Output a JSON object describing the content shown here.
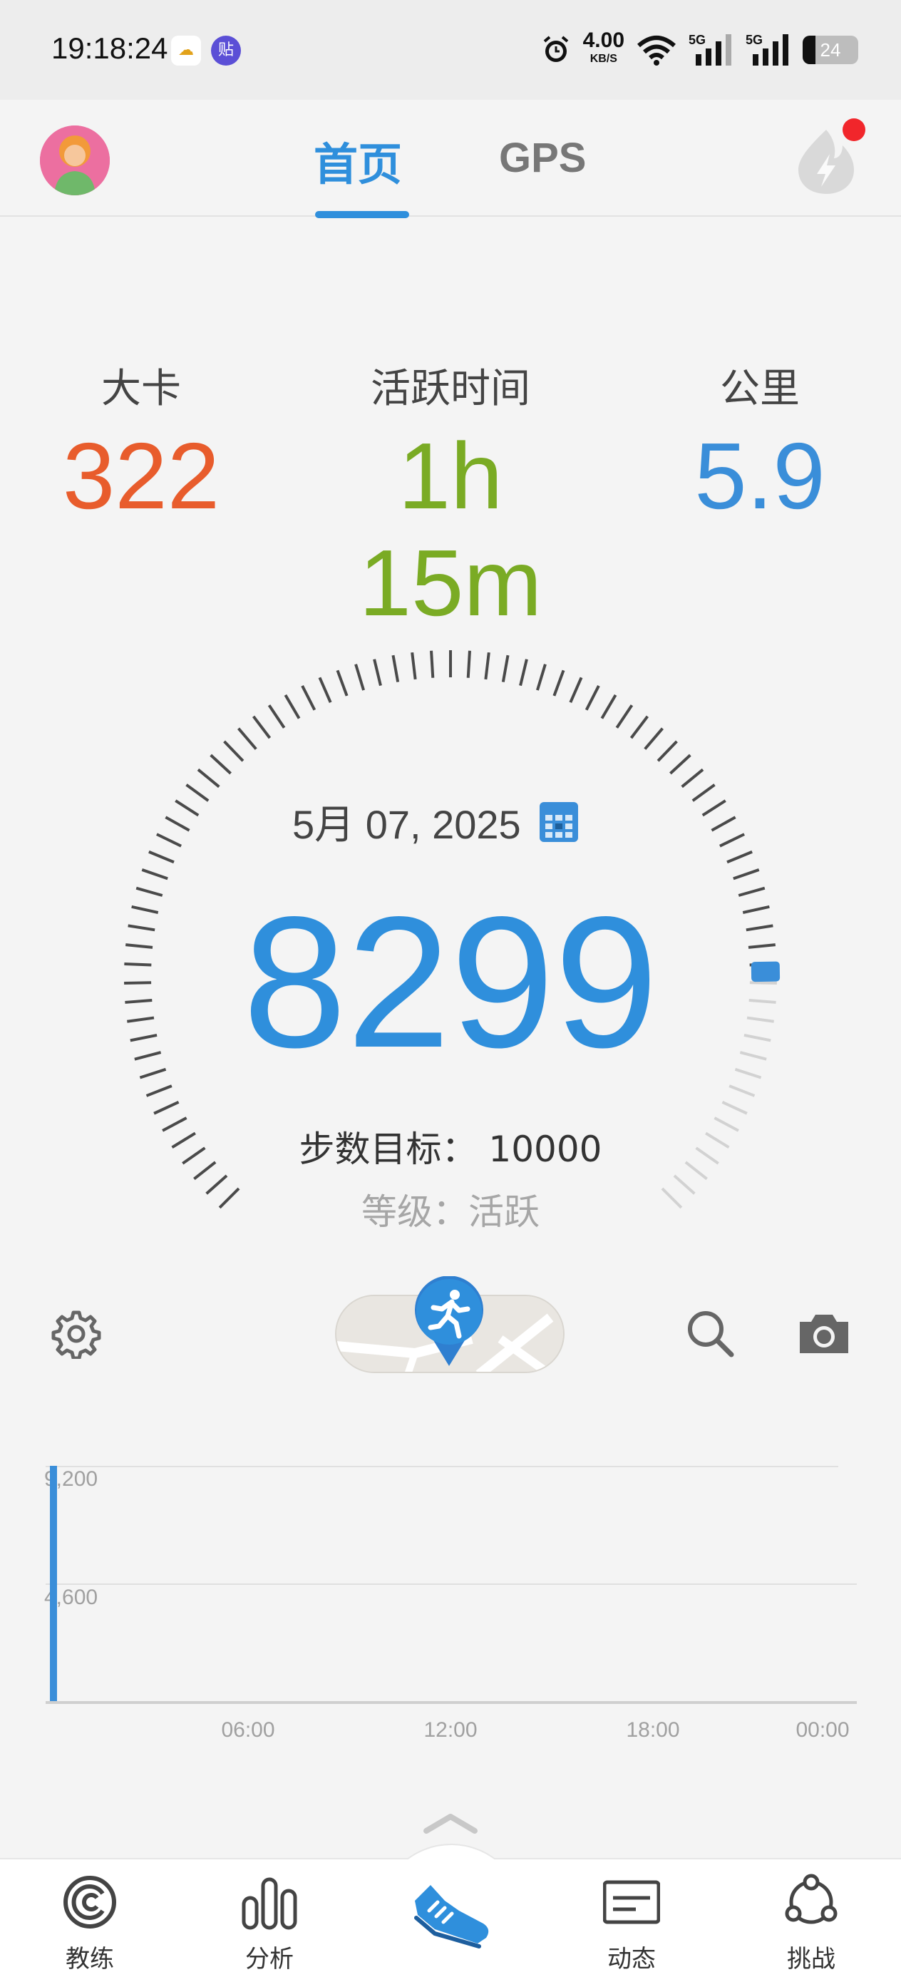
{
  "status_bar": {
    "time": "19:18:24",
    "app_icon_1": "cloud-icon",
    "app_icon_2_text": "贴",
    "net_speed": "4.00",
    "net_unit": "KB/S",
    "signal_1_label": "5G",
    "signal_2_label": "5G",
    "battery": "24"
  },
  "header": {
    "tabs": [
      {
        "label": "首页",
        "active": true
      },
      {
        "label": "GPS",
        "active": false
      }
    ],
    "accent": "#2f8fdc"
  },
  "stats": {
    "calories": {
      "label": "大卡",
      "value": "322",
      "color": "#e85c2c"
    },
    "active_time": {
      "label": "活跃时间",
      "value": "1h 15m",
      "color": "#7aab24"
    },
    "distance": {
      "label": "公里",
      "value": "5.9",
      "color": "#3a8ed9"
    }
  },
  "gauge": {
    "date": "5月 07, 2025",
    "steps": "8299",
    "goal_text": "步数目标：  10000",
    "level_text": "等级：活跃",
    "progress_fraction": 0.8299
  },
  "actions": {
    "settings_icon": "gear-icon",
    "toggle_icon": "running-pin-icon",
    "search_icon": "search-icon",
    "camera_icon": "camera-icon"
  },
  "chart_data": {
    "type": "bar",
    "yticks": [
      "9,200",
      "4,600"
    ],
    "xticks": [
      "06:00",
      "12:00",
      "18:00",
      "00:00"
    ],
    "ylim": [
      0,
      9200
    ],
    "bars": [
      {
        "x": "00:00",
        "value": 9200
      }
    ]
  },
  "bottom_nav": {
    "items": [
      {
        "label": "教练",
        "icon": "coach-icon"
      },
      {
        "label": "分析",
        "icon": "bar-chart-icon"
      },
      {
        "label": "",
        "icon": "shoe-icon"
      },
      {
        "label": "动态",
        "icon": "feed-icon"
      },
      {
        "label": "挑战",
        "icon": "challenge-icon"
      }
    ]
  }
}
